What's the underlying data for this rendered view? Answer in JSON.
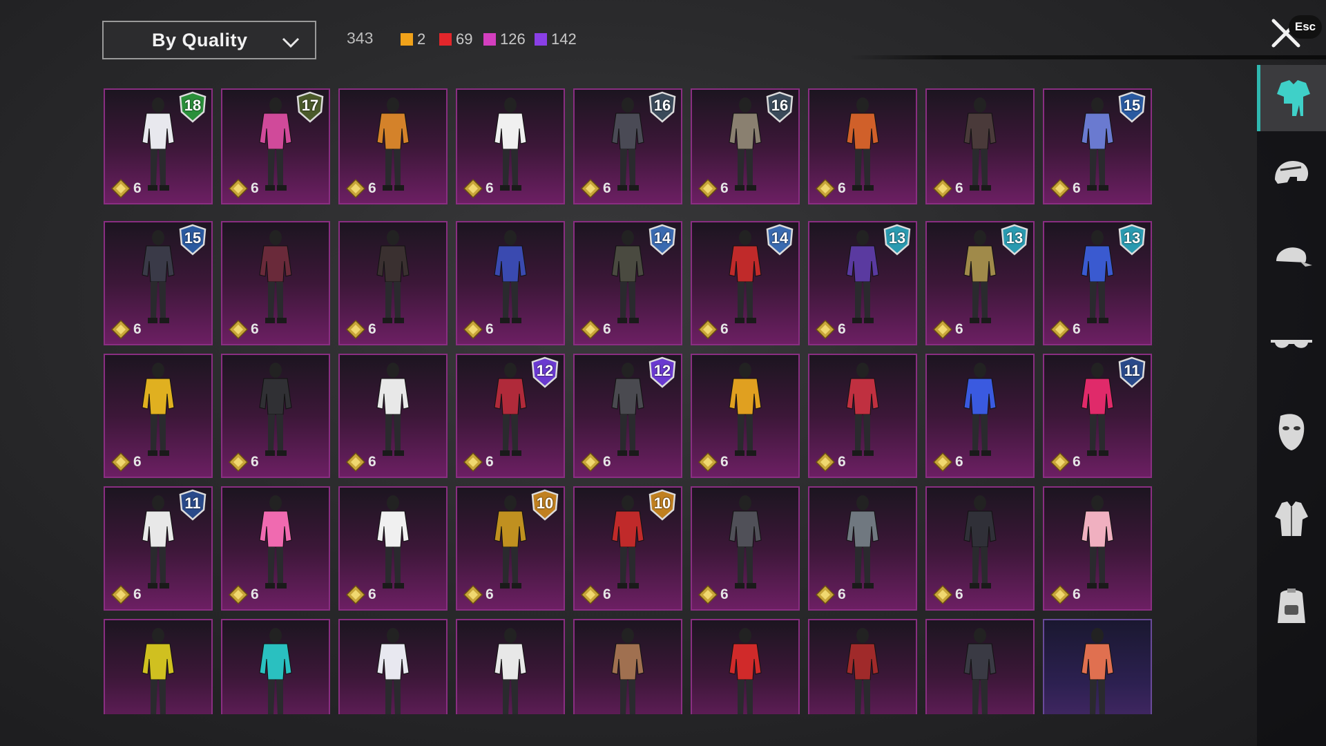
{
  "sort": {
    "label": "By Quality",
    "icon": "chevron-down-icon"
  },
  "summary": {
    "total": "343",
    "legend": [
      {
        "color": "#f0a21a",
        "count": "2"
      },
      {
        "color": "#e3262b",
        "count": "69"
      },
      {
        "color": "#d43fbf",
        "count": "126"
      },
      {
        "color": "#8a3fe6",
        "count": "142"
      }
    ]
  },
  "close": {
    "icon": "close-icon",
    "esc_label": "Esc"
  },
  "grid": {
    "rows": [
      [
        {
          "tier": "6",
          "badge": "18",
          "badge_color": "#2a8f3a",
          "outfit": "#e8e8ee"
        },
        {
          "tier": "6",
          "badge": "17",
          "badge_color": "#4a5a2a",
          "outfit": "#d04a9a"
        },
        {
          "tier": "6",
          "badge": "",
          "badge_color": "",
          "outfit": "#d4822a"
        },
        {
          "tier": "6",
          "badge": "",
          "badge_color": "",
          "outfit": "#f0f0f0"
        },
        {
          "tier": "6",
          "badge": "16",
          "badge_color": "#3a4a5a",
          "outfit": "#4a4a55"
        },
        {
          "tier": "6",
          "badge": "16",
          "badge_color": "#3a4a5a",
          "outfit": "#8a8070"
        },
        {
          "tier": "6",
          "badge": "",
          "badge_color": "",
          "outfit": "#d0602a"
        },
        {
          "tier": "6",
          "badge": "",
          "badge_color": "",
          "outfit": "#4a3a3a"
        },
        {
          "tier": "6",
          "badge": "15",
          "badge_color": "#2a5aa0",
          "outfit": "#6a7ad0"
        }
      ],
      [
        {
          "tier": "6",
          "badge": "15",
          "badge_color": "#2a5aa0",
          "outfit": "#3a3a48"
        },
        {
          "tier": "6",
          "badge": "",
          "badge_color": "",
          "outfit": "#6a2a3a"
        },
        {
          "tier": "6",
          "badge": "",
          "badge_color": "",
          "outfit": "#3a3030"
        },
        {
          "tier": "6",
          "badge": "",
          "badge_color": "",
          "outfit": "#3a4ab0"
        },
        {
          "tier": "6",
          "badge": "14",
          "badge_color": "#3a6ab0",
          "outfit": "#4a4a40"
        },
        {
          "tier": "6",
          "badge": "14",
          "badge_color": "#3a6ab0",
          "outfit": "#c02a2a"
        },
        {
          "tier": "6",
          "badge": "13",
          "badge_color": "#2a9ab0",
          "outfit": "#5a3aa0"
        },
        {
          "tier": "6",
          "badge": "13",
          "badge_color": "#2a9ab0",
          "outfit": "#a08a4a"
        },
        {
          "tier": "6",
          "badge": "13",
          "badge_color": "#2a9ab0",
          "outfit": "#3a5ad0"
        }
      ],
      [
        {
          "tier": "6",
          "badge": "",
          "badge_color": "",
          "outfit": "#e0b020"
        },
        {
          "tier": "6",
          "badge": "",
          "badge_color": "",
          "outfit": "#303034"
        },
        {
          "tier": "6",
          "badge": "",
          "badge_color": "",
          "outfit": "#e8e8e8"
        },
        {
          "tier": "6",
          "badge": "12",
          "badge_color": "#6a3ad0",
          "outfit": "#b02a3a"
        },
        {
          "tier": "6",
          "badge": "12",
          "badge_color": "#6a3ad0",
          "outfit": "#4a4a50"
        },
        {
          "tier": "6",
          "badge": "",
          "badge_color": "",
          "outfit": "#e0a020"
        },
        {
          "tier": "6",
          "badge": "",
          "badge_color": "",
          "outfit": "#c03040"
        },
        {
          "tier": "6",
          "badge": "",
          "badge_color": "",
          "outfit": "#3a5ae0"
        },
        {
          "tier": "6",
          "badge": "11",
          "badge_color": "#2a4a8a",
          "outfit": "#e02a6a"
        }
      ],
      [
        {
          "tier": "6",
          "badge": "11",
          "badge_color": "#2a4a8a",
          "outfit": "#e8e8e8"
        },
        {
          "tier": "6",
          "badge": "",
          "badge_color": "",
          "outfit": "#f06ab0"
        },
        {
          "tier": "6",
          "badge": "",
          "badge_color": "",
          "outfit": "#f0f0f0"
        },
        {
          "tier": "6",
          "badge": "10",
          "badge_color": "#c08020",
          "outfit": "#c09020"
        },
        {
          "tier": "6",
          "badge": "10",
          "badge_color": "#c08020",
          "outfit": "#c02a2a"
        },
        {
          "tier": "6",
          "badge": "",
          "badge_color": "",
          "outfit": "#505058"
        },
        {
          "tier": "6",
          "badge": "",
          "badge_color": "",
          "outfit": "#707880"
        },
        {
          "tier": "6",
          "badge": "",
          "badge_color": "",
          "outfit": "#303038"
        },
        {
          "tier": "6",
          "badge": "",
          "badge_color": "",
          "outfit": "#f0b0c0"
        }
      ],
      [
        {
          "tier": "",
          "badge": "",
          "badge_color": "",
          "outfit": "#d0c020"
        },
        {
          "tier": "",
          "badge": "",
          "badge_color": "",
          "outfit": "#2ac0c0"
        },
        {
          "tier": "",
          "badge": "",
          "badge_color": "",
          "outfit": "#e8e8f0"
        },
        {
          "tier": "",
          "badge": "",
          "badge_color": "",
          "outfit": "#e8e8e8"
        },
        {
          "tier": "",
          "badge": "",
          "badge_color": "",
          "outfit": "#a07050"
        },
        {
          "tier": "",
          "badge": "",
          "badge_color": "",
          "outfit": "#d02a2a"
        },
        {
          "tier": "",
          "badge": "",
          "badge_color": "",
          "outfit": "#a02a2a"
        },
        {
          "tier": "",
          "badge": "",
          "badge_color": "",
          "outfit": "#3a3a44"
        },
        {
          "tier": "",
          "badge": "",
          "badge_color": "",
          "outfit": "#e07050"
        }
      ]
    ]
  },
  "sidebar": {
    "tabs": [
      {
        "icon": "outfit-icon",
        "active": true
      },
      {
        "icon": "helmet-icon",
        "active": false
      },
      {
        "icon": "cap-icon",
        "active": false
      },
      {
        "icon": "glasses-icon",
        "active": false
      },
      {
        "icon": "mask-icon",
        "active": false
      },
      {
        "icon": "jacket-icon",
        "active": false
      },
      {
        "icon": "backpack-icon",
        "active": false
      }
    ]
  }
}
